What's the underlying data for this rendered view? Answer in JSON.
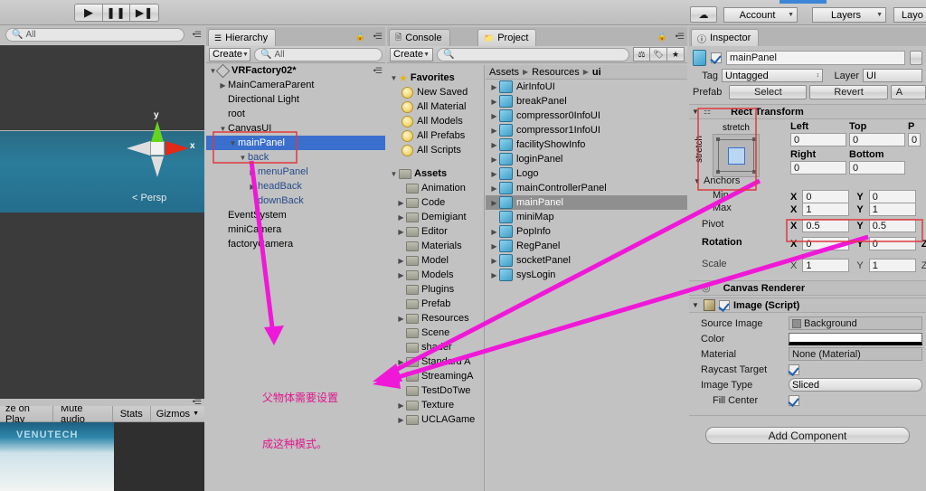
{
  "toolbar": {
    "play_icon": "play-icon",
    "pause_icon": "pause-icon",
    "step_icon": "step-icon",
    "cloud_icon": "cloud-icon",
    "account_label": "Account",
    "layers_label": "Layers",
    "layout_label": "Layo"
  },
  "scene": {
    "search_placeholder": "All",
    "search_icon": "search-icon",
    "gizmo": {
      "y_label": "y",
      "x_label": "x",
      "persp_label": "Persp"
    },
    "watermark": "VENUTECH"
  },
  "game_toolbar": {
    "maximize_label": "ze on Play",
    "mute_label": "Mute audio",
    "stats_label": "Stats",
    "gizmos_label": "Gizmos"
  },
  "hierarchy": {
    "tab_label": "Hierarchy",
    "tab_icon": "list-icon",
    "lock_icon": "lock-icon",
    "menu_icon": "hamburger-icon",
    "create_label": "Create",
    "search_placeholder": "All",
    "scene_name": "VRFactory02*",
    "scene_icon": "unity-scene-icon",
    "items": [
      {
        "label": "MainCameraParent",
        "depth": 1,
        "arrow": "right",
        "selected": false,
        "blue": false
      },
      {
        "label": "Directional Light",
        "depth": 1,
        "arrow": "none",
        "selected": false,
        "blue": false
      },
      {
        "label": "root",
        "depth": 1,
        "arrow": "none",
        "selected": false,
        "blue": false
      },
      {
        "label": "CanvasUI",
        "depth": 1,
        "arrow": "down",
        "selected": false,
        "blue": false
      },
      {
        "label": "mainPanel",
        "depth": 2,
        "arrow": "down",
        "selected": true,
        "blue": true
      },
      {
        "label": "back",
        "depth": 3,
        "arrow": "down",
        "selected": false,
        "blue": true
      },
      {
        "label": "menuPanel",
        "depth": 4,
        "arrow": "right",
        "selected": false,
        "blue": true
      },
      {
        "label": "headBack",
        "depth": 4,
        "arrow": "right",
        "selected": false,
        "blue": true
      },
      {
        "label": "downBack",
        "depth": 4,
        "arrow": "none",
        "selected": false,
        "blue": true
      },
      {
        "label": "EventSystem",
        "depth": 1,
        "arrow": "none",
        "selected": false,
        "blue": false
      },
      {
        "label": "miniCamera",
        "depth": 1,
        "arrow": "none",
        "selected": false,
        "blue": false
      },
      {
        "label": "factoryCamera",
        "depth": 1,
        "arrow": "none",
        "selected": false,
        "blue": false
      }
    ]
  },
  "console": {
    "tab_label": "Console",
    "tab_icon": "console-icon"
  },
  "project": {
    "tab_label": "Project",
    "tab_icon": "folder-icon",
    "lock_icon": "lock-icon",
    "menu_icon": "hamburger-icon",
    "create_label": "Create",
    "search_placeholder": "",
    "filter_icons": [
      "type-filter-icon",
      "label-filter-icon",
      "favorite-filter-icon"
    ],
    "favorites_label": "Favorites",
    "favorites_icon": "star-icon",
    "favorites": [
      "New Saved",
      "All Material",
      "All Models",
      "All Prefabs",
      "All Scripts"
    ],
    "assets_label": "Assets",
    "folders": [
      {
        "label": "Animation",
        "arrow": "none"
      },
      {
        "label": "Code",
        "arrow": "right"
      },
      {
        "label": "Demigiant",
        "arrow": "right"
      },
      {
        "label": "Editor",
        "arrow": "right"
      },
      {
        "label": "Materials",
        "arrow": "none"
      },
      {
        "label": "Model",
        "arrow": "right"
      },
      {
        "label": "Models",
        "arrow": "right"
      },
      {
        "label": "Plugins",
        "arrow": "none"
      },
      {
        "label": "Prefab",
        "arrow": "none"
      },
      {
        "label": "Resources",
        "arrow": "right"
      },
      {
        "label": "Scene",
        "arrow": "none"
      },
      {
        "label": "shader",
        "arrow": "none"
      },
      {
        "label": "Standard A",
        "arrow": "right"
      },
      {
        "label": "StreamingA",
        "arrow": "none"
      },
      {
        "label": "TestDoTwe",
        "arrow": "none"
      },
      {
        "label": "Texture",
        "arrow": "right"
      },
      {
        "label": "UCLAGame",
        "arrow": "right"
      }
    ],
    "breadcrumb": [
      "Assets",
      "Resources",
      "ui"
    ],
    "assets_list": [
      {
        "label": "AirInfoUI",
        "arrow": "right",
        "selected": false
      },
      {
        "label": "breakPanel",
        "arrow": "right",
        "selected": false
      },
      {
        "label": "compressor0InfoUI",
        "arrow": "right",
        "selected": false
      },
      {
        "label": "compressor1InfoUI",
        "arrow": "right",
        "selected": false
      },
      {
        "label": "facilityShowInfo",
        "arrow": "right",
        "selected": false
      },
      {
        "label": "loginPanel",
        "arrow": "right",
        "selected": false
      },
      {
        "label": "Logo",
        "arrow": "right",
        "selected": false
      },
      {
        "label": "mainControllerPanel",
        "arrow": "right",
        "selected": false
      },
      {
        "label": "mainPanel",
        "arrow": "right",
        "selected": true
      },
      {
        "label": "miniMap",
        "arrow": "none",
        "selected": false
      },
      {
        "label": "PopInfo",
        "arrow": "right",
        "selected": false
      },
      {
        "label": "RegPanel",
        "arrow": "right",
        "selected": false
      },
      {
        "label": "socketPanel",
        "arrow": "right",
        "selected": false
      },
      {
        "label": "sysLogin",
        "arrow": "right",
        "selected": false
      }
    ]
  },
  "inspector": {
    "tab_label": "Inspector",
    "tab_icon": "info-icon",
    "object_icon": "prefab-cube-icon",
    "object_name": "mainPanel",
    "object_enabled": true,
    "tag_label": "Tag",
    "tag_value": "Untagged",
    "layer_label": "Layer",
    "layer_value": "UI",
    "prefab_label": "Prefab",
    "prefab_select": "Select",
    "prefab_revert": "Revert",
    "prefab_apply": "A",
    "rect_transform": {
      "title": "Rect Transform",
      "anchor_preset_top": "stretch",
      "anchor_preset_side": "stretch",
      "left_label": "Left",
      "left_value": "0",
      "top_label": "Top",
      "top_value": "0",
      "posz_label": "P",
      "posz_value": "0",
      "right_label": "Right",
      "right_value": "0",
      "bottom_label": "Bottom",
      "bottom_value": "0",
      "anchors_label": "Anchors",
      "min_label": "Min",
      "min_x": "0",
      "min_y": "0",
      "max_label": "Max",
      "max_x": "1",
      "max_y": "1",
      "pivot_label": "Pivot",
      "pivot_x": "0.5",
      "pivot_y": "0.5",
      "rotation_label": "Rotation",
      "rot_x": "0",
      "rot_y": "0",
      "rot_z": "Z",
      "scale_label": "Scale",
      "scale_x": "1",
      "scale_y": "1",
      "scale_z": "Z",
      "x_axis": "X",
      "y_axis": "Y"
    },
    "canvas_renderer": {
      "title": "Canvas Renderer",
      "icon": "canvas-renderer-icon"
    },
    "image_script": {
      "title": "Image (Script)",
      "enabled": true,
      "icon": "script-icon",
      "source_image_label": "Source Image",
      "source_image_value": "Background",
      "color_label": "Color",
      "color_value": "#FFFFFF",
      "material_label": "Material",
      "material_value": "None (Material)",
      "raycast_label": "Raycast Target",
      "raycast_checked": true,
      "image_type_label": "Image Type",
      "image_type_value": "Sliced",
      "fill_center_label": "Fill Center",
      "fill_center_checked": true
    },
    "add_component_label": "Add Component"
  },
  "annotation": {
    "text_line1": "父物体需要设置",
    "text_line2": "成这种模式。",
    "color": "#e0178f"
  }
}
